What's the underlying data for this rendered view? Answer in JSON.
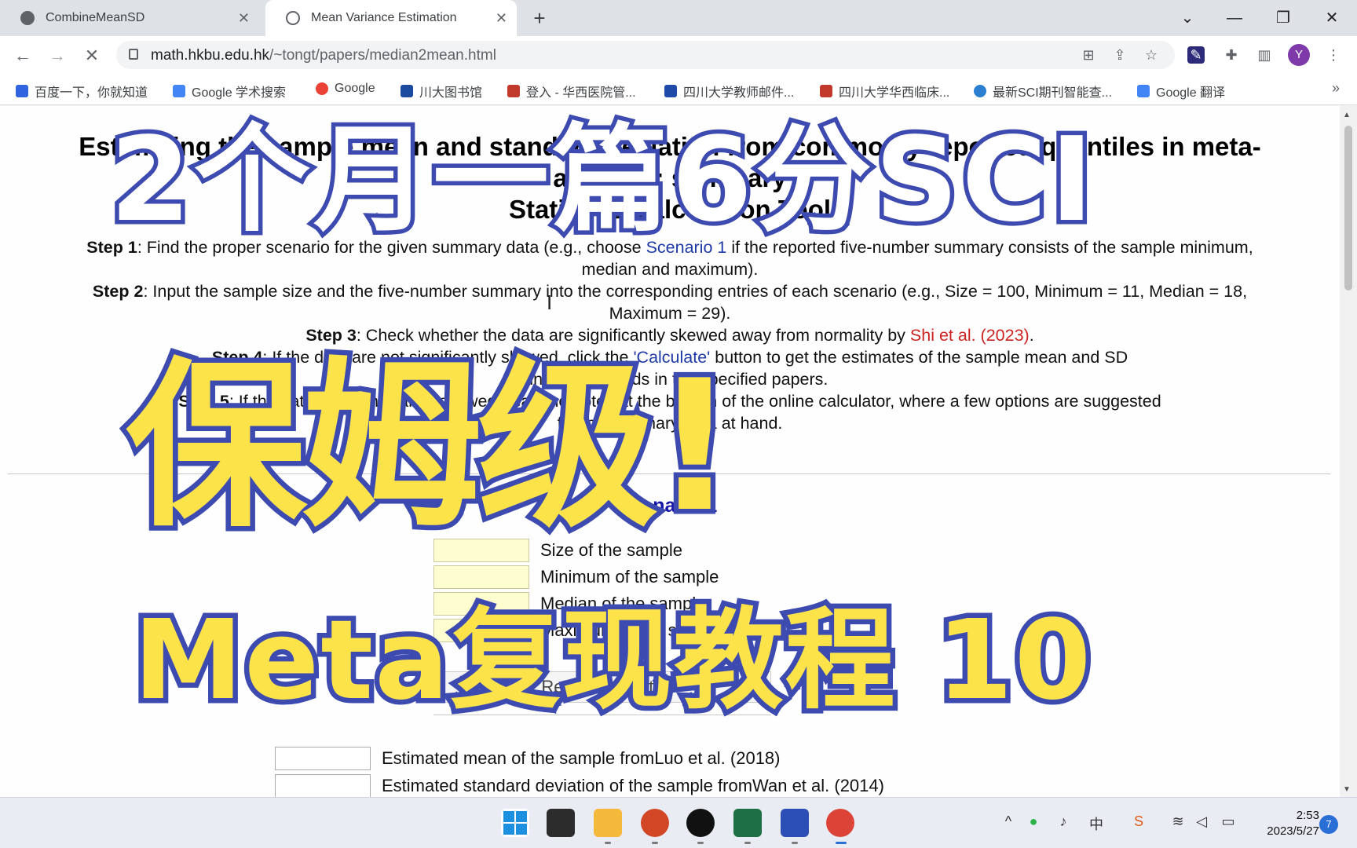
{
  "tabs": [
    {
      "title": "CombineMeanSD",
      "close": "✕",
      "active": false
    },
    {
      "title": "Mean Variance Estimation",
      "close": "✕",
      "active": true
    }
  ],
  "new_tab": "+",
  "window_controls": {
    "dropdown": "⌄",
    "minimize": "—",
    "restore": "❐",
    "close": "✕"
  },
  "nav": {
    "back": "←",
    "forward": "→",
    "reload": "✕"
  },
  "address": {
    "domain": "math.hkbu.edu.hk",
    "path": "/~tongt/papers/median2mean.html"
  },
  "profile_initial": "Y",
  "bookmarks": [
    {
      "label": "百度一下，你就知道",
      "icon": "baidu-icon",
      "color": "#2f63e0"
    },
    {
      "label": "Google 学术搜索",
      "icon": "scholar-icon",
      "color": "#4285f4"
    },
    {
      "label": "Google",
      "icon": "google-icon",
      "color": "#ea4335"
    },
    {
      "label": "川大图书馆",
      "icon": "library-icon",
      "color": "#1a4aa0"
    },
    {
      "label": "登入 - 华西医院管...",
      "icon": "hospital-icon",
      "color": "#c0392b"
    },
    {
      "label": "四川大学教师邮件...",
      "icon": "mail-icon",
      "color": "#1f4aa8"
    },
    {
      "label": "四川大学华西临床...",
      "icon": "clinic-icon",
      "color": "#c0392b"
    },
    {
      "label": "最新SCI期刊智能查...",
      "icon": "journal-icon",
      "color": "#2a7fd0"
    },
    {
      "label": "Google 翻译",
      "icon": "translate-icon",
      "color": "#4285f4"
    }
  ],
  "bookmarks_more": "»",
  "page": {
    "title_line1": "Estimating the sample mean and standard deviation from commonly reported quantiles in meta-analysis: summary",
    "title_line2": "Statistics Calculation Tool",
    "steps": [
      {
        "label": "Step 1",
        "text1": ": Find the proper scenario for the given summary data (e.g., choose ",
        "link": "Scenario 1",
        "text2": " if the reported five-number summary consists of the sample minimum,",
        "line2": "median and maximum)."
      },
      {
        "label": "Step 2",
        "text1": ": Input the sample size and the five-number summary into the corresponding entries of each scenario (e.g., Size = 100, Minimum = 11, Median = 18,",
        "line2": "Maximum = 29)."
      },
      {
        "label": "Step 3",
        "text1": ": Check whether the data are significantly skewed away from normality by ",
        "ref": "Shi et al. (2023)",
        "text2": "."
      },
      {
        "label": "Step 4",
        "text1": ": If the data are not significantly skewed, click the ",
        "link": "'Calculate'",
        "text2": " button to get the estimates of the sample mean and SD",
        "line2": "using the methods in the specified papers."
      },
      {
        "label": "Step 5",
        "text1": ": If the data are significantly skewed, read the notes at the bottom of the online calculator, where a few options are suggested",
        "line2": "for the summary data at hand."
      }
    ],
    "scenario_title": "Scenario 1",
    "inputs": [
      "Size of the sample",
      "Minimum of the sample",
      "Median of the sample",
      "Maximum of the sample"
    ],
    "reset_label": "Reset   Calculate",
    "outputs": [
      {
        "text": "Estimated mean of the sample from ",
        "ref": "Luo et al. (2018)"
      },
      {
        "text": "Estimated standard deviation of the sample from ",
        "ref": "Wan et al. (2014)"
      }
    ]
  },
  "overlay": {
    "line1": "2个月一篇6分SCI",
    "line2": "保姆级!",
    "line3": "Meta复现教程 10"
  },
  "taskbar": {
    "clock_time": "2:53",
    "clock_date": "2023/5/27",
    "notification_count": "7",
    "tray_ime": "中"
  },
  "colors": {
    "overlay_outline": "#3d4ab0",
    "overlay_yellow": "#fde34a",
    "ref_red": "#cc2222",
    "link_blue": "#1f3aa7",
    "scenario_blue": "#1414a8"
  }
}
